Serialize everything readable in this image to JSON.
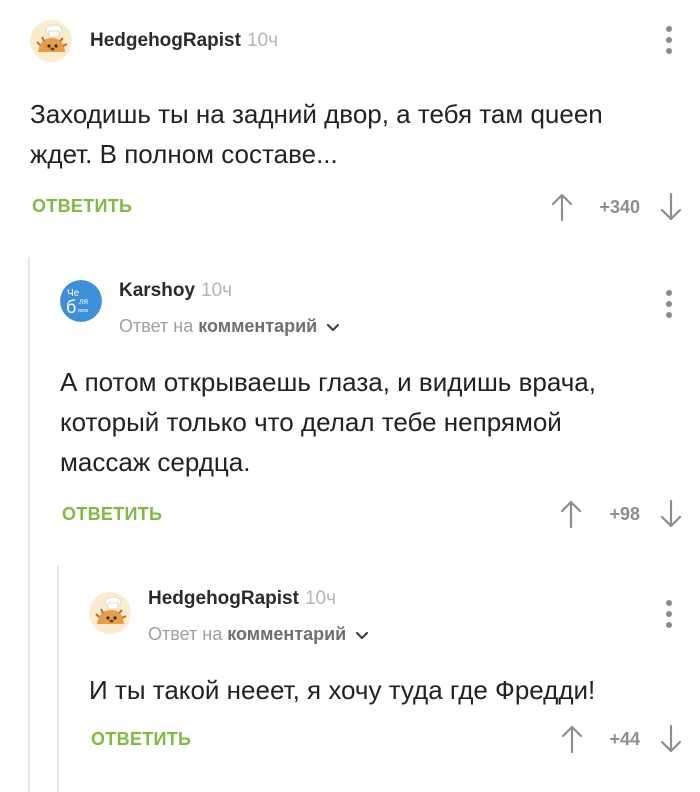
{
  "comments": [
    {
      "author": "HedgehogRapist",
      "time": "10ч",
      "reply_prefix": "",
      "reply_target": "",
      "lines": [
        "Заходишь ты на задний двор, а тебя там queen",
        "ждет. В полном составе..."
      ],
      "reply_label": "ОТВЕТИТЬ",
      "score": "+340",
      "avatar_icon": "hedgehog-chef-avatar"
    },
    {
      "author": "Karshoy",
      "time": "10ч",
      "reply_prefix": "Ответ на",
      "reply_target": "комментарий",
      "lines": [
        "А потом открываешь глаза, и видишь врача,",
        "который только что делал тебе непрямой",
        "массаж сердца."
      ],
      "reply_label": "ОТВЕТИТЬ",
      "score": "+98",
      "avatar_icon": "chelyabinsk-logo-avatar",
      "avatar_text": {
        "l1": "Че",
        "l2": "б",
        "l3": "ля",
        "l4": "инск"
      }
    },
    {
      "author": "HedgehogRapist",
      "time": "10ч",
      "reply_prefix": "Ответ на",
      "reply_target": "комментарий",
      "lines": [
        "И ты такой нееет, я хочу туда где Фредди!"
      ],
      "reply_label": "ОТВЕТИТЬ",
      "score": "+44",
      "avatar_icon": "hedgehog-chef-avatar"
    }
  ],
  "colors": {
    "accent_green": "#7cbd3f",
    "score_gray": "#8e8e8e",
    "thread_line": "#e6e6e6",
    "avatar_blue": "#3d8fd8"
  }
}
